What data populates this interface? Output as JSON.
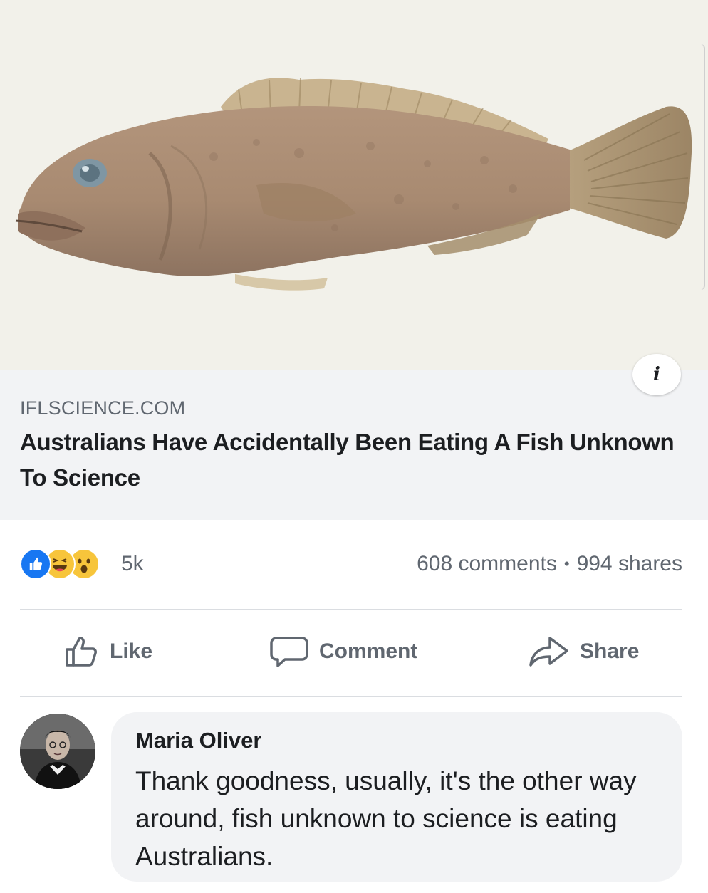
{
  "link_preview": {
    "image_subject": "fish-photo",
    "domain": "IFLSCIENCE.COM",
    "title": "Australians Have Accidentally Been Eating A Fish Unknown To Science",
    "info_icon": "i"
  },
  "reactions": {
    "icons": [
      "like-reaction-icon",
      "haha-reaction-icon",
      "wow-reaction-icon"
    ],
    "count": "5k",
    "comments": "608 comments",
    "separator": "•",
    "shares": "994 shares"
  },
  "actions": {
    "like_label": "Like",
    "comment_label": "Comment",
    "share_label": "Share"
  },
  "comment": {
    "author": "Maria Oliver",
    "text": "Thank goodness, usually, it's the other way around, fish unknown to science is eating Australians."
  },
  "colors": {
    "like_blue": "#1877f2",
    "reaction_yellow": "#f7c53b",
    "secondary_text": "#606770",
    "primary_text": "#1c1e21",
    "caption_bg": "#f2f3f5"
  }
}
